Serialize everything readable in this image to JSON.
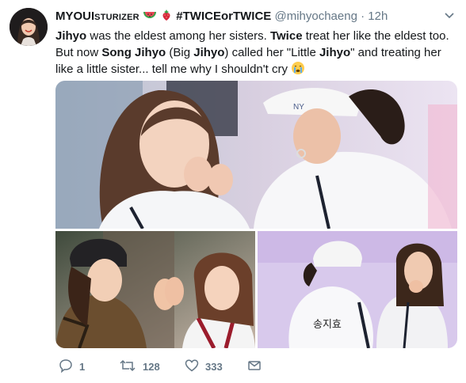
{
  "tweet": {
    "display_name_prefix": "MYOUI",
    "display_name_smallcaps": "STURIZER",
    "display_name_hashtag": "#TWICEorTWICE",
    "handle": "@mihyochaeng",
    "dot": "·",
    "time": "12h",
    "text_parts": [
      {
        "t": "Jihyo",
        "b": true
      },
      {
        "t": " was the eldest among her sisters. ",
        "b": false
      },
      {
        "t": "Twice",
        "b": true
      },
      {
        "t": " treat her like the eldest too. But now ",
        "b": false
      },
      {
        "t": "Song Jihyo",
        "b": true
      },
      {
        "t": " (Big ",
        "b": false
      },
      {
        "t": "Jihyo",
        "b": true
      },
      {
        "t": ") called her \"Little ",
        "b": false
      },
      {
        "t": "Jihyo",
        "b": true
      },
      {
        "t": "\" and treating her like a little sister... tell me why I shouldn't cry ",
        "b": false
      }
    ],
    "jacket_label": "송지효"
  },
  "actions": {
    "reply_count": "1",
    "retweet_count": "128",
    "like_count": "333"
  },
  "icons": {
    "reply": "reply-icon",
    "retweet": "retweet-icon",
    "like": "heart-icon",
    "dm": "envelope-icon",
    "caret": "chevron-down-icon"
  },
  "colors": {
    "text": "#14171a",
    "secondary": "#657786",
    "background": "#ffffff"
  }
}
